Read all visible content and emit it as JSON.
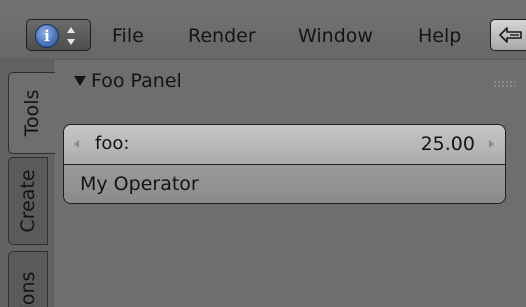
{
  "header": {
    "editor_type_icon": "info-icon",
    "editor_type_glyph": "i",
    "menus": [
      "File",
      "Render",
      "Window",
      "Help"
    ],
    "collapse_icon": "collapse-menus-icon"
  },
  "tabs": [
    "Tools",
    "Create",
    "ions"
  ],
  "panel": {
    "title": "Foo Panel",
    "expanded": true,
    "number_field": {
      "label": "foo:",
      "value": "25.00"
    },
    "operator_button": {
      "label": "My Operator"
    }
  },
  "colors": {
    "background": "#6e6e6e",
    "field": "#bcbcbc",
    "button": "#939393",
    "info_icon": "#3e68b0",
    "text": "#141414"
  }
}
